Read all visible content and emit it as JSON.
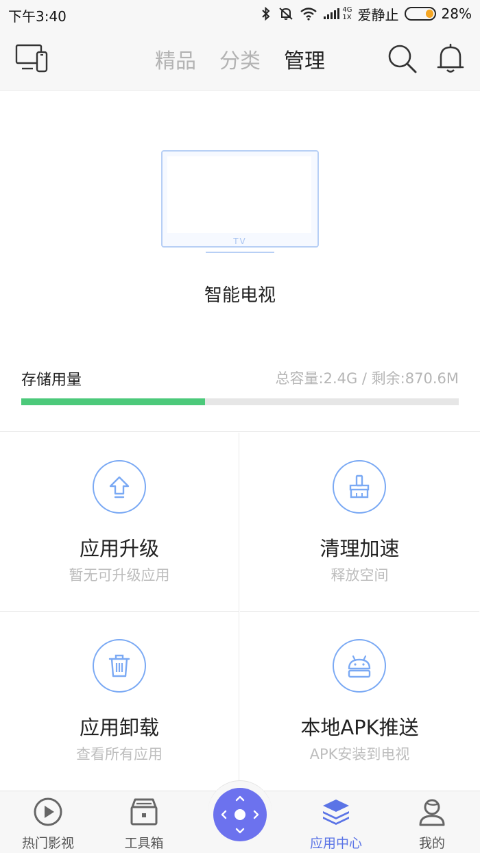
{
  "status_bar": {
    "time": "下午3:40",
    "network": "4G",
    "network_sub": "1X",
    "carrier": "爱静止",
    "battery_percent": "28%",
    "battery_level": 0.28
  },
  "header": {
    "tabs": [
      {
        "label": "精品",
        "active": false
      },
      {
        "label": "分类",
        "active": false
      },
      {
        "label": "管理",
        "active": true
      }
    ]
  },
  "device": {
    "screen_label": "TV",
    "name": "智能电视"
  },
  "storage": {
    "label": "存储用量",
    "info": "总容量:2.4G / 剩余:870.6M",
    "used_fraction": 0.42
  },
  "features": [
    {
      "icon": "upgrade-icon",
      "title": "应用升级",
      "subtitle": "暂无可升级应用"
    },
    {
      "icon": "broom-icon",
      "title": "清理加速",
      "subtitle": "释放空间"
    },
    {
      "icon": "trash-icon",
      "title": "应用卸载",
      "subtitle": "查看所有应用"
    },
    {
      "icon": "android-icon",
      "title": "本地APK推送",
      "subtitle": "APK安装到电视"
    }
  ],
  "bottom_nav": [
    {
      "label": "热门影视",
      "icon": "play-circle-icon",
      "active": false
    },
    {
      "label": "工具箱",
      "icon": "toolbox-icon",
      "active": false
    },
    {
      "label": "应用中心",
      "icon": "layers-icon",
      "active": true
    },
    {
      "label": "我的",
      "icon": "user-icon",
      "active": false
    }
  ],
  "colors": {
    "accent_blue": "#7aa9f4",
    "active_nav": "#5b74e6",
    "remote_button": "#6c72ee",
    "storage_green": "#4cc97a",
    "battery_orange": "#f5a623"
  }
}
